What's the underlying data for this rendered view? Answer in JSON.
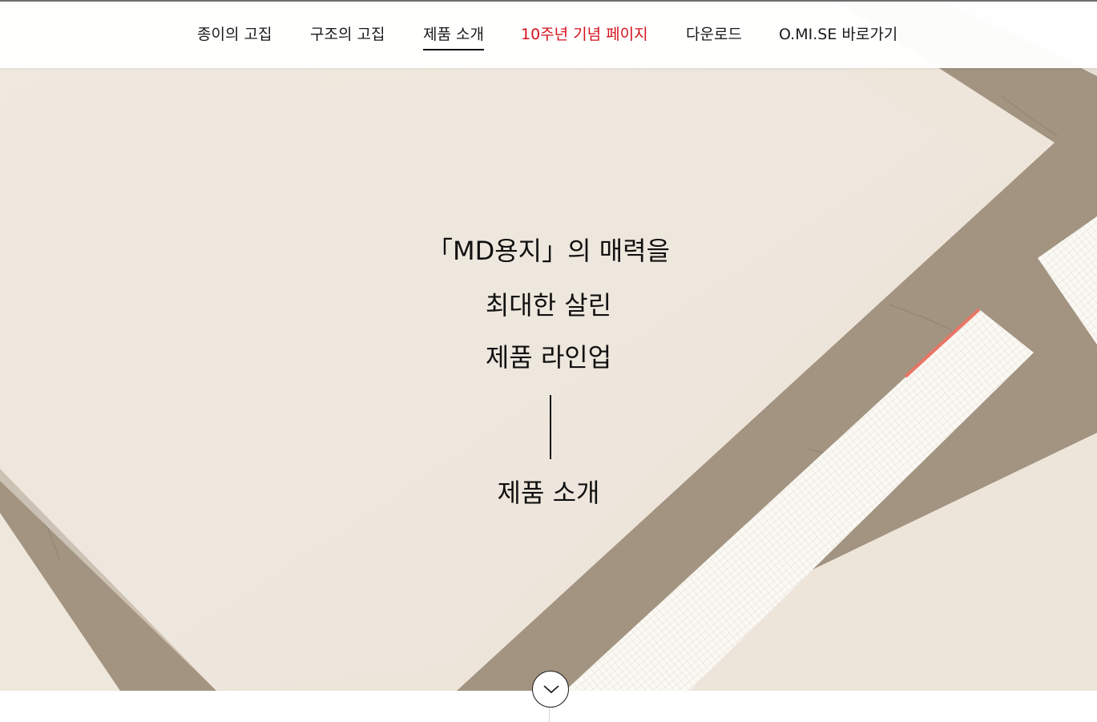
{
  "nav": {
    "items": [
      {
        "label": "종이의 고집",
        "accent": false,
        "active": false
      },
      {
        "label": "구조의 고집",
        "accent": false,
        "active": false
      },
      {
        "label": "제품 소개",
        "accent": false,
        "active": true
      },
      {
        "label": "10주년 기념 페이지",
        "accent": true,
        "active": false
      },
      {
        "label": "다운로드",
        "accent": false,
        "active": false
      },
      {
        "label": "O.MI.SE 바로가기",
        "accent": false,
        "active": false
      }
    ]
  },
  "hero": {
    "line1": "「MD용지」의 매력을",
    "line2": "최대한 살린",
    "line3": "제품 라인업",
    "section_title": "제품 소개"
  },
  "scroll_button": {
    "icon": "chevron-down-icon"
  },
  "colors": {
    "accent": "#d4121c",
    "text": "#111111",
    "paper": "#efe7dc",
    "stone": "#a89a88"
  }
}
